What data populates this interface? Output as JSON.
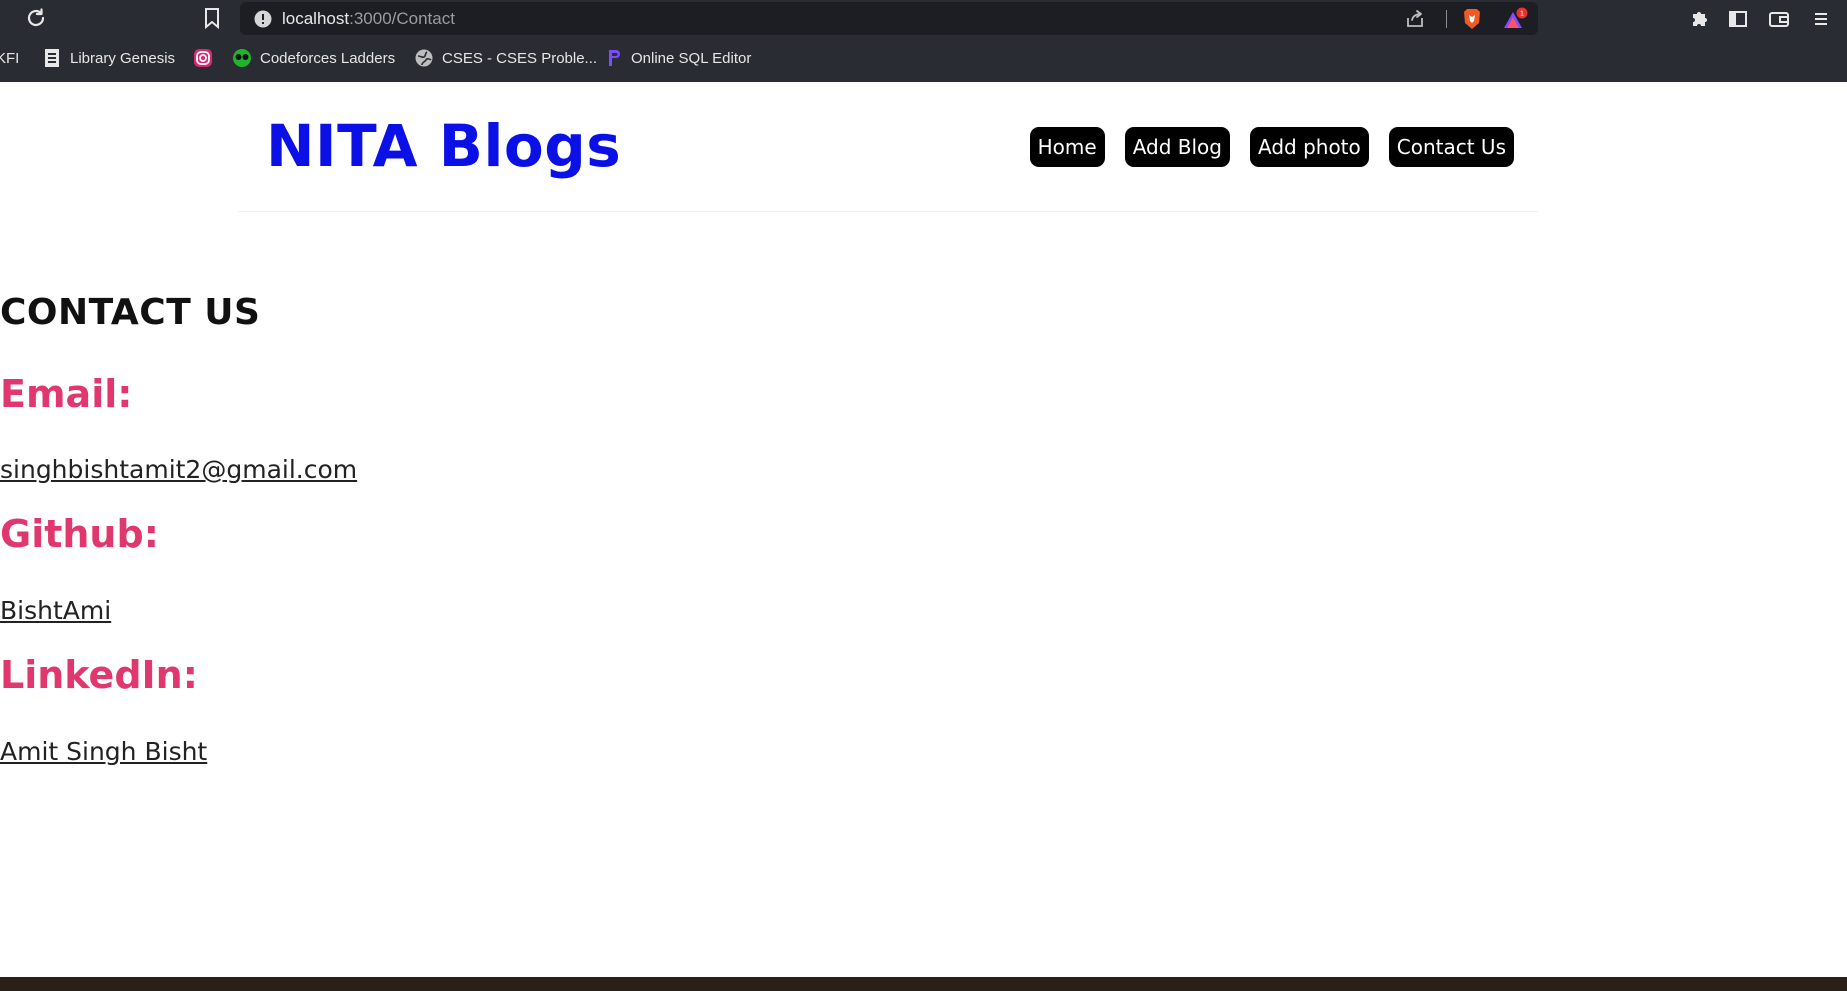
{
  "browser": {
    "url_host": "localhost",
    "url_path": ":3000/Contact",
    "bookmarks": [
      {
        "label": "KFI",
        "icon": "bookmark-generic-icon"
      },
      {
        "label": "Library Genesis",
        "icon": "library-icon"
      },
      {
        "label": "",
        "icon": "instagram-icon"
      },
      {
        "label": "Codeforces Ladders",
        "icon": "codeforces-icon"
      },
      {
        "label": "CSES - CSES Proble...",
        "icon": "globe-icon"
      },
      {
        "label": "Online SQL Editor",
        "icon": "sql-editor-icon"
      }
    ],
    "rewards_badge": "1"
  },
  "navbar": {
    "brand": "NITA Blogs",
    "links": [
      "Home",
      "Add Blog",
      "Add photo",
      "Contact Us"
    ]
  },
  "contact": {
    "title": "CONTACT US",
    "email_heading": "Email:",
    "email_value": "singhbishtamit2@gmail.com",
    "github_heading": "Github:",
    "github_value": "BishtAmi",
    "linkedin_heading": "LinkedIn:",
    "linkedin_value": "Amit Singh Bisht"
  },
  "colors": {
    "brand": "#0a10e6",
    "section_heading": "#e0386e",
    "nav_button_bg": "#000000"
  }
}
